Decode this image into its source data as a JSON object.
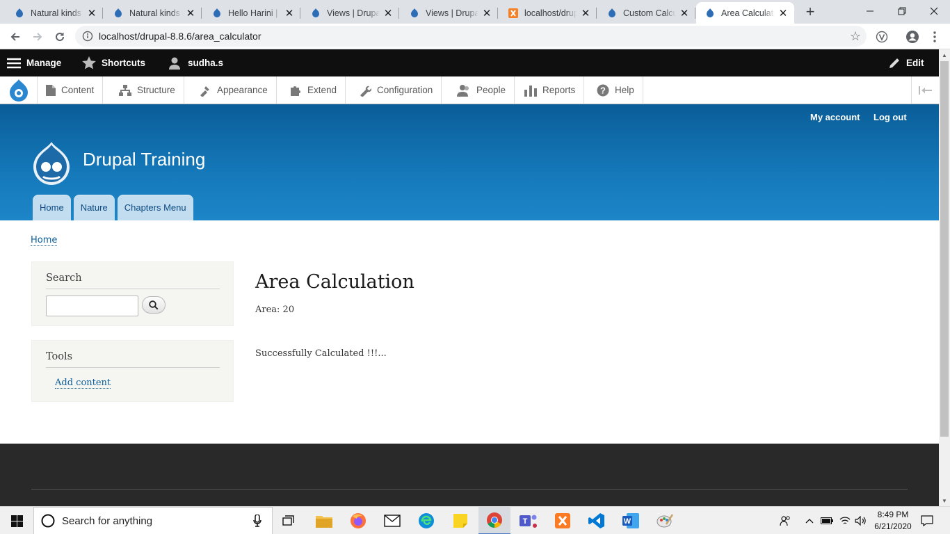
{
  "browser": {
    "tabs": [
      {
        "title": "Natural kinds |",
        "icon": "drupal-favicon",
        "active": false
      },
      {
        "title": "Natural kinds (",
        "icon": "drupal-favicon",
        "active": false
      },
      {
        "title": "Hello Harini | D",
        "icon": "drupal-favicon",
        "active": false
      },
      {
        "title": "Views | Drupal",
        "icon": "drupal-favicon",
        "active": false
      },
      {
        "title": "Views | Drupal",
        "icon": "drupal-favicon",
        "active": false
      },
      {
        "title": "localhost/drup",
        "icon": "xampp-favicon",
        "active": false
      },
      {
        "title": "Custom Calcul",
        "icon": "drupal-favicon",
        "active": false
      },
      {
        "title": "Area Calculatio",
        "icon": "drupal-favicon",
        "active": true
      }
    ],
    "url": "localhost/drupal-8.8.6/area_calculator"
  },
  "admin_toolbar": {
    "manage": "Manage",
    "shortcuts": "Shortcuts",
    "user": "sudha.s",
    "edit": "Edit",
    "tray": [
      {
        "label": "Content",
        "icon": "content-icon"
      },
      {
        "label": "Structure",
        "icon": "structure-icon"
      },
      {
        "label": "Appearance",
        "icon": "appearance-icon"
      },
      {
        "label": "Extend",
        "icon": "extend-icon"
      },
      {
        "label": "Configuration",
        "icon": "configuration-icon"
      },
      {
        "label": "People",
        "icon": "people-icon"
      },
      {
        "label": "Reports",
        "icon": "reports-icon"
      },
      {
        "label": "Help",
        "icon": "help-icon"
      }
    ]
  },
  "header": {
    "site_name": "Drupal Training",
    "secondary_menu": [
      "My account",
      "Log out"
    ],
    "main_menu": [
      "Home",
      "Nature",
      "Chapters Menu"
    ]
  },
  "breadcrumb": "Home",
  "sidebar": {
    "search_title": "Search",
    "tools_title": "Tools",
    "tools_link": "Add content"
  },
  "main": {
    "title": "Area Calculation",
    "area_text": "Area: 20",
    "message": "Successfully Calculated !!!..."
  },
  "taskbar": {
    "search_placeholder": "Search for anything",
    "time": "8:49 PM",
    "date": "6/21/2020"
  },
  "colors": {
    "header_blue": "#1579ba",
    "admin_black": "#0f0f0f",
    "link_blue": "#0b5e9b",
    "footer": "#292929"
  }
}
